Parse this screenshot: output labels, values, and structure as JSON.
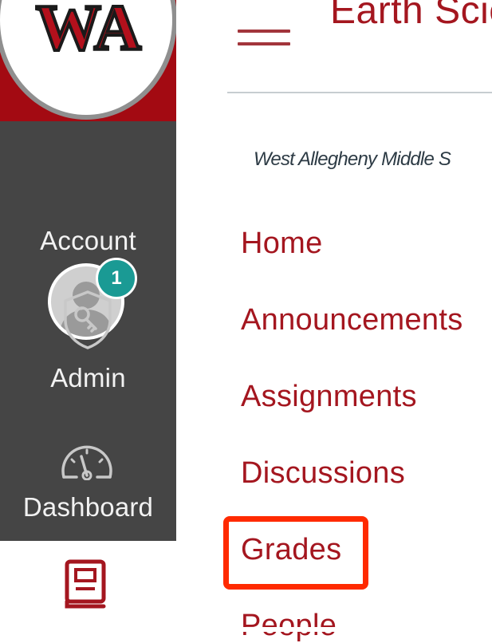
{
  "global_nav": {
    "logo_text": "WA",
    "account": {
      "label": "Account",
      "badge_count": "1"
    },
    "admin": {
      "label": "Admin"
    },
    "dashboard": {
      "label": "Dashboard"
    },
    "courses": {
      "icon": "book-icon"
    }
  },
  "header": {
    "menu_icon": "hamburger-icon",
    "course_title": "Earth Scie",
    "school_name": "West Allegheny Middle S"
  },
  "course_nav": {
    "items": [
      {
        "label": "Home"
      },
      {
        "label": "Announcements"
      },
      {
        "label": "Assignments"
      },
      {
        "label": "Discussions"
      },
      {
        "label": "Grades"
      },
      {
        "label": "People"
      }
    ],
    "highlighted": "Grades"
  },
  "colors": {
    "brand_red": "#a4161f",
    "nav_bg": "#454545",
    "badge": "#1a9a94",
    "highlight_border": "#ff2a00"
  }
}
